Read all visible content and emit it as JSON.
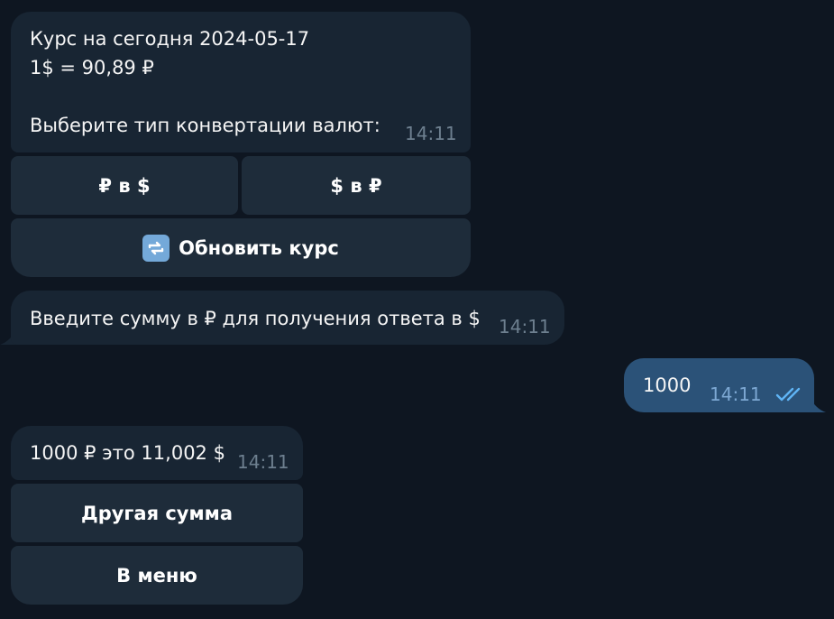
{
  "messages": {
    "rate": {
      "line1": "Курс на сегодня 2024-05-17",
      "line2": "1$ = 90,89 ₽",
      "line3": "Выберите тип конвертации валют:",
      "time": "14:11"
    },
    "prompt": {
      "text": "Введите сумму в ₽ для получения ответа в $",
      "time": "14:11"
    },
    "user_input": {
      "text": "1000",
      "time": "14:11",
      "status": "read"
    },
    "result": {
      "text": "1000 ₽ это 11,002 $",
      "time": "14:11"
    }
  },
  "keyboard_rate": {
    "rub_to_usd": "₽ в $",
    "usd_to_rub": "$ в ₽",
    "refresh": "Обновить курс",
    "refresh_icon": "repeat-icon"
  },
  "keyboard_result": {
    "other_amount": "Другая сумма",
    "menu": "В меню"
  },
  "colors": {
    "background": "#0e1621",
    "incoming_bubble": "#182533",
    "outgoing_bubble": "#2b5278",
    "button": "#1e2c3a",
    "timestamp": "#6d7f8f",
    "read_check": "#5fb4f5"
  }
}
